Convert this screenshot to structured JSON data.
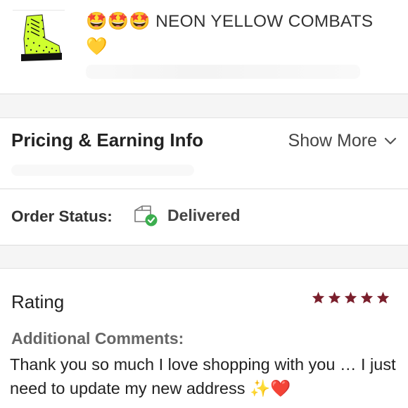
{
  "listing": {
    "title_emoji_prefix": "🤩🤩🤩",
    "title_text": "NEON YELLOW COMBATS",
    "title_emoji_suffix": "💛",
    "thumbnail_icon": "neon-yellow-boot-image"
  },
  "pricing": {
    "label": "Pricing & Earning Info",
    "show_more": "Show More",
    "chevron_icon": "chevron-down-icon"
  },
  "order_status": {
    "label": "Order Status:",
    "value": "Delivered",
    "icon": "package-delivered-icon",
    "check_color": "#3cae4f"
  },
  "rating": {
    "label": "Rating",
    "stars": 5,
    "star_color": "#7a1f2c",
    "comments_label": "Additional Comments:",
    "comments_text": "Thank you so much I love shopping with you … I just need to update my new address ✨❤️"
  }
}
